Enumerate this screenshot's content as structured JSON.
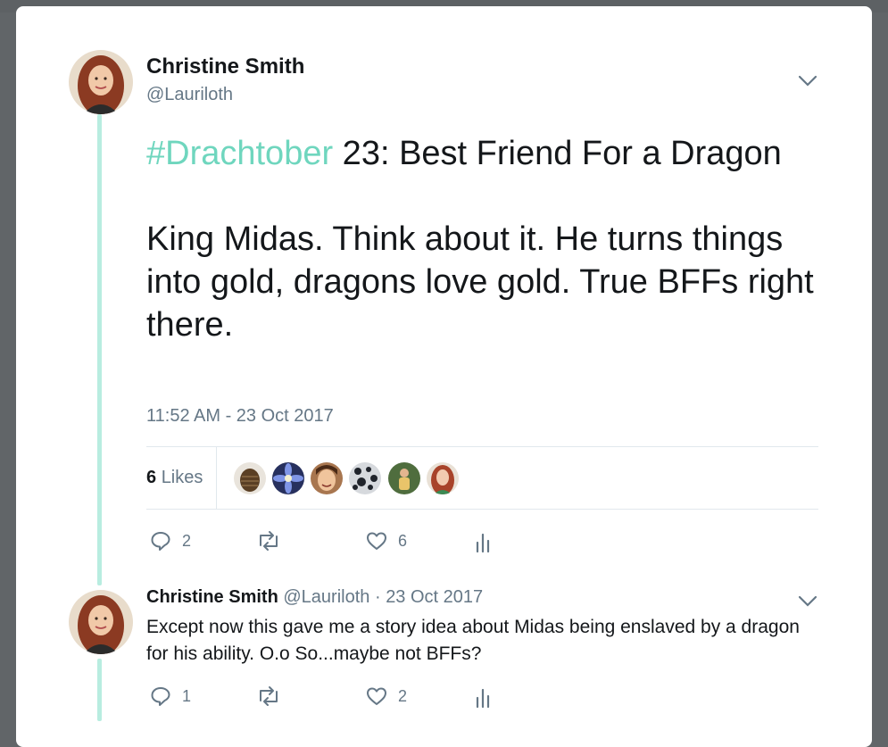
{
  "tweet": {
    "author_name": "Christine Smith",
    "author_handle": "@Lauriloth",
    "hashtag": "#Drachtober",
    "text_head": " 23: Best Friend For a Dragon",
    "text_body": "King Midas. Think about it. He turns things into gold, dragons love gold. True BFFs right there.",
    "timestamp": "11:52 AM - 23 Oct 2017",
    "likes_count": "6",
    "likes_label": "Likes",
    "likers": [
      {
        "name": "pinecone",
        "color": "#5a3f24"
      },
      {
        "name": "blue-flower",
        "color": "#5566b8"
      },
      {
        "name": "woman-smiling",
        "color": "#c98e62"
      },
      {
        "name": "black-white-pattern",
        "color": "#cfd2d6"
      },
      {
        "name": "person-outdoors",
        "color": "#6c8a53"
      },
      {
        "name": "redhead-woman",
        "color": "#d99a88"
      }
    ],
    "actions": {
      "reply_count": "2",
      "retweet_count": "",
      "like_count": "6"
    }
  },
  "reply": {
    "author_name": "Christine Smith",
    "author_handle": "@Lauriloth",
    "separator": "·",
    "date": "23 Oct 2017",
    "text": "Except now this gave me a story idea about Midas being enslaved by a dragon for his ability. O.o So...maybe not BFFs?",
    "actions": {
      "reply_count": "1",
      "retweet_count": "",
      "like_count": "2"
    }
  },
  "colors": {
    "hashtag": "#6fd6be",
    "thread_line": "#b8ede0",
    "secondary_text": "#657786"
  }
}
